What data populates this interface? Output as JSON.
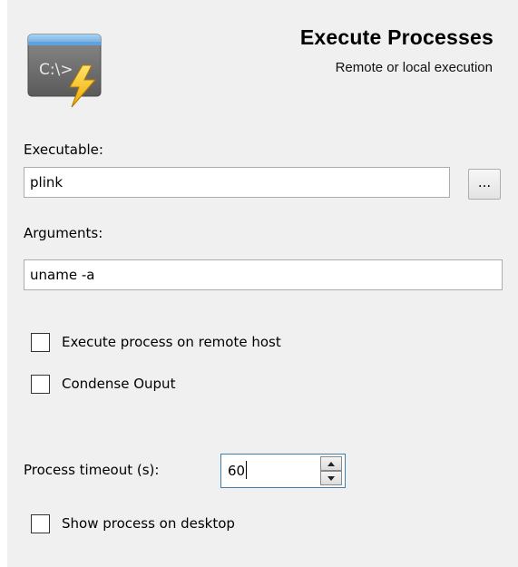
{
  "header": {
    "title": "Execute Processes",
    "subtitle": "Remote or local execution",
    "icon": "console-lightning-icon",
    "icon_text": "C:\\>"
  },
  "executable": {
    "label": "Executable:",
    "value": "plink",
    "browse_label": "..."
  },
  "arguments": {
    "label": "Arguments:",
    "value": "uname -a"
  },
  "options": {
    "remote_host": {
      "label": "Execute process on remote host",
      "checked": false
    },
    "condense_output": {
      "label": "Condense Ouput",
      "checked": false
    },
    "show_desktop": {
      "label": "Show process on desktop",
      "checked": false
    }
  },
  "timeout": {
    "label": "Process timeout (s):",
    "value": "60"
  },
  "colors": {
    "panel_bg": "#f0f0f0",
    "focus_border": "#3c7fb1",
    "icon_blue": "#7fb8e8",
    "lightning": "#f6b800"
  }
}
